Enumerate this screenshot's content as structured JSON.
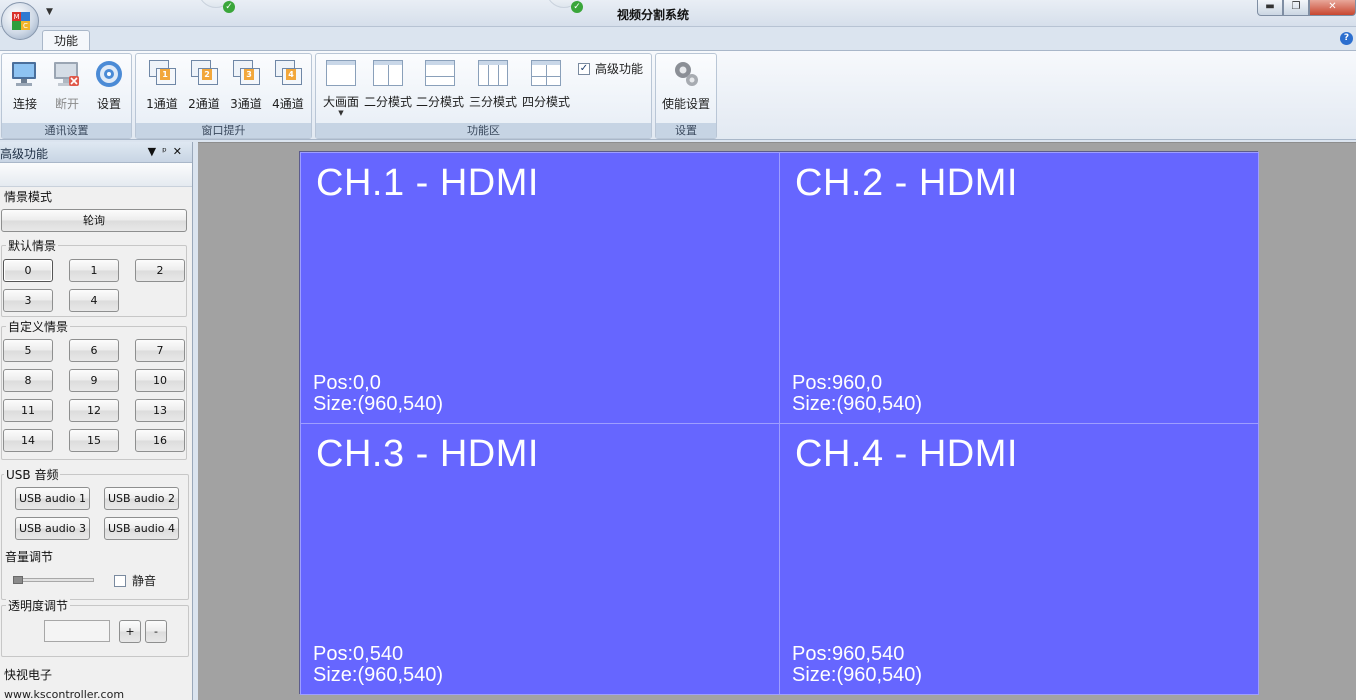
{
  "titlebar": {
    "title": "视频分割系统",
    "minimize_icon": "minimize-icon",
    "maximize_icon": "restore-icon",
    "close_icon": "close-icon"
  },
  "ribbon": {
    "tabs": [
      {
        "label": "功能",
        "active": true
      }
    ],
    "groups": [
      {
        "label": "通讯设置",
        "buttons": [
          {
            "label": "连接",
            "icon": "computer-connect-icon",
            "enabled": true
          },
          {
            "label": "断开",
            "icon": "computer-disconnect-icon",
            "enabled": false
          },
          {
            "label": "设置",
            "icon": "settings-gear-icon",
            "enabled": true
          }
        ]
      },
      {
        "label": "窗口提升",
        "buttons": [
          {
            "label": "1通道",
            "number": "1"
          },
          {
            "label": "2通道",
            "number": "2"
          },
          {
            "label": "3通道",
            "number": "3"
          },
          {
            "label": "4通道",
            "number": "4"
          }
        ]
      },
      {
        "label": "功能区",
        "buttons": [
          {
            "label": "大画面",
            "icon": "single-layout-icon",
            "has_dropdown": true
          },
          {
            "label": "二分模式",
            "icon": "two-split-vertical-icon"
          },
          {
            "label": "二分模式",
            "icon": "two-split-horizontal-icon"
          },
          {
            "label": "三分模式",
            "icon": "three-split-icon"
          },
          {
            "label": "四分模式",
            "icon": "four-split-icon"
          }
        ],
        "checkbox": {
          "label": "高级功能",
          "checked": true
        }
      },
      {
        "label": "设置",
        "buttons": [
          {
            "label": "使能设置",
            "icon": "gears-icon"
          }
        ]
      }
    ]
  },
  "panel": {
    "title": "高级功能",
    "controls": [
      "▼",
      "ᵖ",
      "✕"
    ],
    "scene_mode": {
      "legend": "情景模式",
      "button": "轮询"
    },
    "default_scenes": {
      "legend": "默认情景",
      "buttons": [
        "0",
        "1",
        "2",
        "3",
        "4"
      ],
      "selected": "0"
    },
    "custom_scenes": {
      "legend": "自定义情景",
      "buttons": [
        "5",
        "6",
        "7",
        "8",
        "9",
        "10",
        "11",
        "12",
        "13",
        "14",
        "15",
        "16"
      ]
    },
    "usb_audio": {
      "legend": "USB 音频",
      "buttons": [
        "USB audio 1",
        "USB audio 2",
        "USB audio 3",
        "USB audio 4"
      ]
    },
    "volume": {
      "label": "音量调节",
      "level": 0.0,
      "mute_label": "静音",
      "muted": false
    },
    "opacity": {
      "legend": "透明度调节",
      "value": "",
      "plus": "+",
      "minus": "-"
    },
    "company": "快视电子",
    "website": "www.kscontroller.com"
  },
  "workspace": {
    "background": "#a2a2a2",
    "channel_color": "#6666ff",
    "channels": [
      {
        "title": "CH.1 - HDMI",
        "pos": "Pos:0,0",
        "size": "Size:(960,540)"
      },
      {
        "title": "CH.2 - HDMI",
        "pos": "Pos:960,0",
        "size": "Size:(960,540)"
      },
      {
        "title": "CH.3 - HDMI",
        "pos": "Pos:0,540",
        "size": "Size:(960,540)"
      },
      {
        "title": "CH.4 - HDMI",
        "pos": "Pos:960,540",
        "size": "Size:(960,540)"
      }
    ]
  }
}
